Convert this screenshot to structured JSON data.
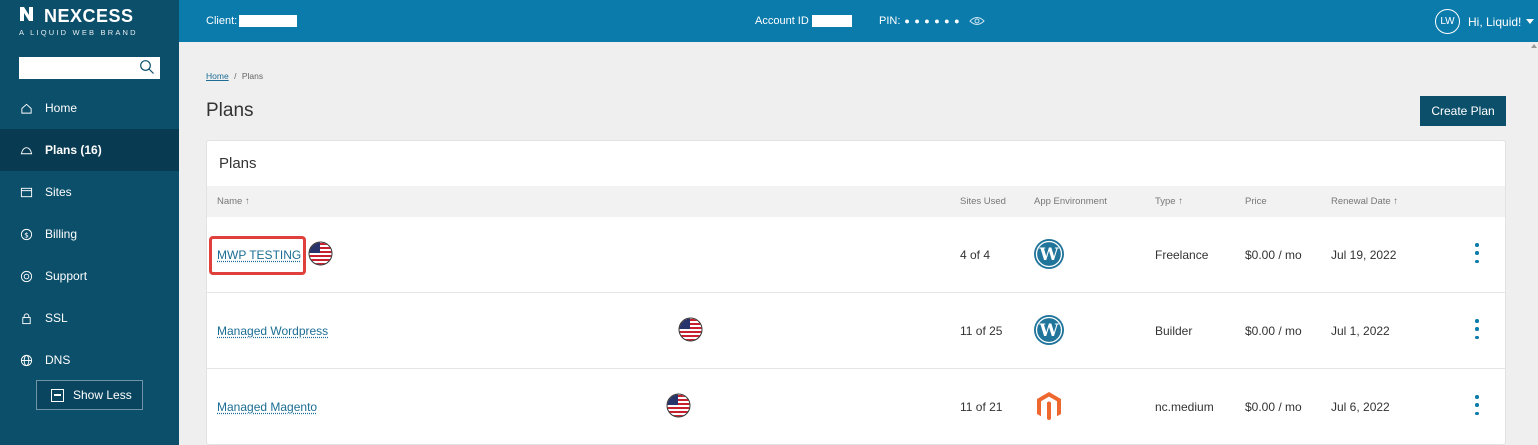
{
  "brand": {
    "name": "NEXCESS",
    "tagline": "A LIQUID WEB BRAND"
  },
  "search": {
    "placeholder": "",
    "value": ""
  },
  "sidebar": {
    "items": [
      {
        "label": "Home",
        "icon": "home-icon",
        "active": false
      },
      {
        "label": "Plans (16)",
        "icon": "cloud-icon",
        "active": true
      },
      {
        "label": "Sites",
        "icon": "browser-window-icon",
        "active": false
      },
      {
        "label": "Billing",
        "icon": "dollar-circle-icon",
        "active": false
      },
      {
        "label": "Support",
        "icon": "lifebuoy-icon",
        "active": false
      },
      {
        "label": "SSL",
        "icon": "lock-icon",
        "active": false
      },
      {
        "label": "DNS",
        "icon": "globe-icon",
        "active": false
      }
    ],
    "show_less_label": "Show Less"
  },
  "topbar": {
    "client_label": "Client:",
    "account_label": "Account ID",
    "pin_label": "PIN:",
    "pin_mask": "● ● ● ● ● ●",
    "avatar_initials": "LW",
    "greeting": "Hi, Liquid!"
  },
  "breadcrumb": {
    "home": "Home",
    "separator": "/",
    "current": "Plans"
  },
  "page": {
    "title": "Plans",
    "create_button": "Create Plan"
  },
  "table": {
    "title": "Plans",
    "columns": {
      "name": "Name ↑",
      "sites_used": "Sites Used",
      "app_env": "App Environment",
      "type": "Type ↑",
      "price": "Price",
      "renewal": "Renewal Date ↑"
    },
    "rows": [
      {
        "name": "MWP TESTING",
        "sites_used": "4 of 4",
        "app_env": "wordpress-icon",
        "type": "Freelance",
        "price": "$0.00 / mo",
        "renewal": "Jul 19, 2022",
        "region_flag": "us-flag-icon",
        "highlighted": true
      },
      {
        "name": "Managed Wordpress",
        "sites_used": "11 of 25",
        "app_env": "wordpress-icon",
        "type": "Builder",
        "price": "$0.00 / mo",
        "renewal": "Jul 1, 2022",
        "region_flag": "us-flag-icon",
        "highlighted": false
      },
      {
        "name": "Managed Magento",
        "sites_used": "11 of 21",
        "app_env": "magento-icon",
        "type": "nc.medium",
        "price": "$0.00 / mo",
        "renewal": "Jul 6, 2022",
        "region_flag": "us-flag-icon",
        "highlighted": false
      }
    ]
  },
  "colors": {
    "sidebar": "#0c4f6b",
    "topbar": "#0b7bac",
    "link": "#1b6d93",
    "highlight": "#e0403c",
    "wordpress": "#21759b",
    "magento": "#ee672f"
  }
}
